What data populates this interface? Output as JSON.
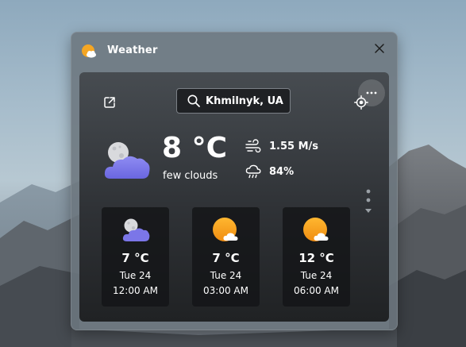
{
  "app": {
    "title": "Weather",
    "icon": "sun-cloud-icon",
    "close_icon": "close-icon"
  },
  "toolbar": {
    "share_icon": "open-external-icon",
    "more_icon": "ellipsis-icon",
    "locate_icon": "locate-icon"
  },
  "search": {
    "icon": "search-icon",
    "value": "Khmilnyk, UA"
  },
  "current": {
    "temperature": "8 °C",
    "description": "few clouds",
    "icon": "moon-cloud-icon",
    "wind": {
      "icon": "wind-icon",
      "value": "1.55  M/s"
    },
    "humidity": {
      "icon": "rain-cloud-icon",
      "value": "84%"
    }
  },
  "forecast": [
    {
      "icon": "moon-cloud-icon",
      "temp": "7 °C",
      "date": "Tue 24",
      "time": "12:00 AM"
    },
    {
      "icon": "sun-cloud-icon",
      "temp": "7 °C",
      "date": "Tue 24",
      "time": "03:00 AM"
    },
    {
      "icon": "sun-cloud-icon",
      "temp": "12 °C",
      "date": "Tue 24",
      "time": "06:00 AM"
    }
  ],
  "colors": {
    "sun": "#f5a623",
    "cloud_purple": "#7b76e8",
    "card_bg": "#2f3236",
    "tile_bg": "#141517",
    "text": "#ffffff"
  }
}
